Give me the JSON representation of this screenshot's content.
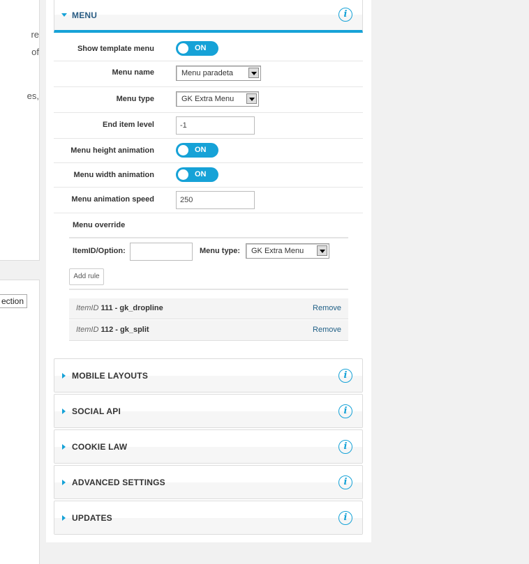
{
  "left": {
    "fragments": [
      "re",
      "of",
      "es,"
    ],
    "button_label": "ection"
  },
  "menu_section": {
    "title": "MENU",
    "rows": {
      "show_template_menu": {
        "label": "Show template menu",
        "value": "ON"
      },
      "menu_name": {
        "label": "Menu name",
        "value": "Menu paradeta"
      },
      "menu_type": {
        "label": "Menu type",
        "value": "GK Extra Menu"
      },
      "end_item_level": {
        "label": "End item level",
        "value": "-1"
      },
      "menu_height_animation": {
        "label": "Menu height animation",
        "value": "ON"
      },
      "menu_width_animation": {
        "label": "Menu width animation",
        "value": "ON"
      },
      "menu_animation_speed": {
        "label": "Menu animation speed",
        "value": "250"
      }
    },
    "override": {
      "title": "Menu override",
      "itemid_label": "ItemID/Option:",
      "itemid_value": "",
      "type_label": "Menu type:",
      "type_value": "GK Extra Menu",
      "add_rule_label": "Add rule",
      "rules": [
        {
          "prefix": "ItemID",
          "id": "111",
          "name": "- gk_dropline",
          "action": "Remove"
        },
        {
          "prefix": "ItemID",
          "id": "112",
          "name": "- gk_split",
          "action": "Remove"
        }
      ]
    }
  },
  "sections": [
    {
      "title": "MOBILE LAYOUTS"
    },
    {
      "title": "SOCIAL API"
    },
    {
      "title": "COOKIE LAW"
    },
    {
      "title": "ADVANCED SETTINGS"
    },
    {
      "title": "UPDATES"
    }
  ],
  "info_icon_glyph": "i",
  "colors": {
    "accent": "#16a2d7",
    "link": "#1f5f86",
    "background": "#f1f1f1"
  }
}
